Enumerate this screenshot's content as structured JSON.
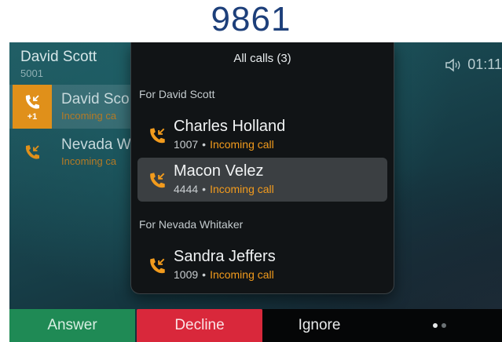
{
  "device": {
    "model_label": "9861"
  },
  "line": {
    "name": "David Scott",
    "extension": "5001"
  },
  "status": {
    "time": "01:11",
    "speaker_icon": "speaker-icon"
  },
  "background_calls": [
    {
      "name": "David Sco",
      "subtitle": "Incoming ca",
      "badge": "+1",
      "selected": true
    },
    {
      "name": "Nevada W",
      "subtitle": "Incoming ca",
      "selected": false
    }
  ],
  "popup": {
    "title": "All calls (3)",
    "sections": [
      {
        "header": "For David Scott",
        "calls": [
          {
            "name": "Charles Holland",
            "number": "1007",
            "separator": "•",
            "state": "Incoming call",
            "selected": false
          },
          {
            "name": "Macon Velez",
            "number": "4444",
            "separator": "•",
            "state": "Incoming call",
            "selected": true
          }
        ]
      },
      {
        "header": "For Nevada Whitaker",
        "calls": [
          {
            "name": "Sandra Jeffers",
            "number": "1009",
            "separator": "•",
            "state": "Incoming call",
            "selected": false
          }
        ]
      }
    ]
  },
  "softkeys": {
    "answer": "Answer",
    "decline": "Decline",
    "ignore": "Ignore",
    "page_current": 1,
    "page_total": 2
  },
  "colors": {
    "accent_orange": "#f29b1d",
    "answer_green": "#1f8a55",
    "decline_red": "#d9283b"
  }
}
